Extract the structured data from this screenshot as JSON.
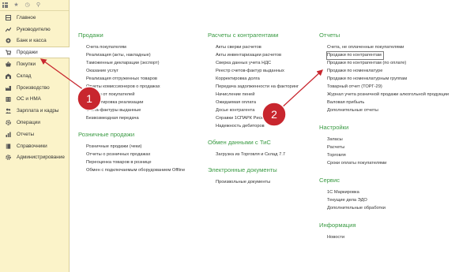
{
  "sidebar": {
    "items": [
      {
        "label": "Главное",
        "icon": "home-icon"
      },
      {
        "label": "Руководителю",
        "icon": "trend-icon"
      },
      {
        "label": "Банк и касса",
        "icon": "coins-icon"
      },
      {
        "label": "Продажи",
        "icon": "cart-icon",
        "active": true
      },
      {
        "label": "Покупки",
        "icon": "basket-icon"
      },
      {
        "label": "Склад",
        "icon": "warehouse-icon"
      },
      {
        "label": "Производство",
        "icon": "factory-icon"
      },
      {
        "label": "ОС и НМА",
        "icon": "building-icon"
      },
      {
        "label": "Зарплата и кадры",
        "icon": "people-icon"
      },
      {
        "label": "Операции",
        "icon": "operations-icon"
      },
      {
        "label": "Отчеты",
        "icon": "chart-icon"
      },
      {
        "label": "Справочники",
        "icon": "book-icon"
      },
      {
        "label": "Администрирование",
        "icon": "gear-icon"
      }
    ]
  },
  "columns": {
    "col1": {
      "sections": [
        {
          "title": "Продажи",
          "links": [
            "Счета покупателям",
            "Реализация (акты, накладные)",
            "Таможенные декларации (экспорт)",
            "Оказание услуг",
            "Реализация отгруженных товаров",
            "Отчеты комиссионеров о продажах",
            "Отчеты от покупателей",
            "Корректировка реализации",
            "Счета-фактуры выданные",
            "Безвозмездная передача"
          ]
        },
        {
          "title": "Розничные продажи",
          "links": [
            "Розничные продажи (чеки)",
            "Отчеты о розничных продажах",
            "Переоценка товаров в рознице",
            "Обмен с подключаемым оборудованием Offline"
          ]
        }
      ]
    },
    "col2": {
      "sections": [
        {
          "title": "Расчеты с контрагентами",
          "links": [
            "Акты сверки расчетов",
            "Акты инвентаризации расчетов",
            "Сверка данных учета НДС",
            "Реестр счетов-фактур выданных",
            "Корректировка долга",
            "Передача задолженности на факторинг",
            "Начисление пеней",
            "Ожидаемая оплата",
            "Досье контрагента",
            "Справки 1СПАРК Риски",
            "Надежность дебиторов"
          ]
        },
        {
          "title": "Обмен данными с ТиС",
          "links": [
            "Загрузка из Торговля и Склад 7.7"
          ]
        },
        {
          "title": "Электронные документы",
          "links": [
            "Произвольные документы"
          ]
        }
      ]
    },
    "col3": {
      "sections": [
        {
          "title": "Отчеты",
          "links": [
            "Счета, не оплаченные покупателями",
            "Продажи по контрагентам",
            "Продажи по контрагентам (по оплате)",
            "Продажи по номенклатуре",
            "Продажи по номенклатурным группам",
            "Товарный отчет (ТОРГ-29)",
            "Журнал учета розничной продажи алкогольной продукции",
            "Валовая прибыль",
            "Дополнительные отчеты"
          ]
        },
        {
          "title": "Настройки",
          "links": [
            "Запасы",
            "Расчеты",
            "Торговля",
            "Сроки оплаты покупателями"
          ]
        },
        {
          "title": "Сервис",
          "links": [
            "1С Маркировка",
            "Текущие дела ЭДО",
            "Дополнительные обработки"
          ]
        },
        {
          "title": "Информация",
          "links": [
            "Новости"
          ]
        }
      ]
    }
  },
  "annotations": [
    {
      "number": "1",
      "color": "#c8262e"
    },
    {
      "number": "2",
      "color": "#c8262e"
    }
  ],
  "colors": {
    "sidebar_bg": "#fbf3c9",
    "section_title": "#3b9b44",
    "marker": "#c8262e"
  }
}
